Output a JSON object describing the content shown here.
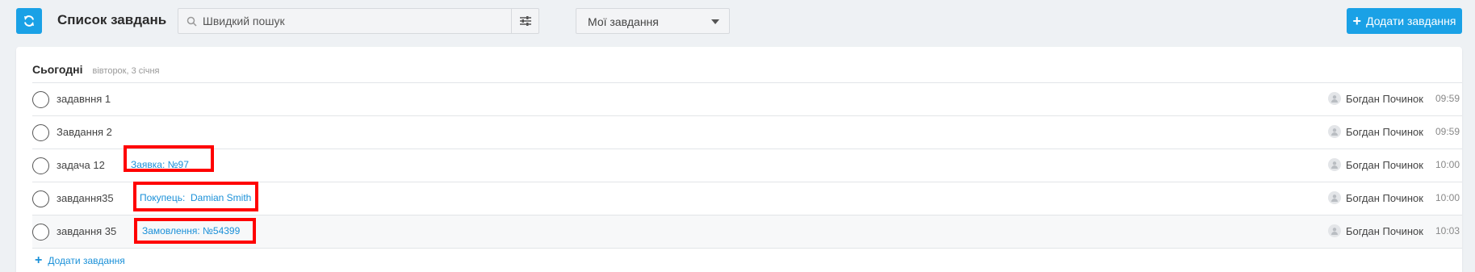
{
  "header": {
    "title": "Список завдань",
    "search_placeholder": "Швидкий пошук",
    "filter_selected": "Мої завдання",
    "add_button_label": "Додати завдання"
  },
  "section": {
    "title": "Сьогодні",
    "date": "вівторок, 3 січня"
  },
  "tasks": [
    {
      "title": "задавння 1",
      "link": "",
      "assignee": "Богдан Починок",
      "time": "09:59"
    },
    {
      "title": "Завдання 2",
      "link": "",
      "assignee": "Богдан Починок",
      "time": "09:59"
    },
    {
      "title": "задача 12",
      "link": "Заявка: №97",
      "assignee": "Богдан Починок",
      "time": "10:00"
    },
    {
      "title": "завдання35",
      "link": "Покупець:  Damian Smith",
      "assignee": "Богдан Починок",
      "time": "10:00"
    },
    {
      "title": "завдання 35",
      "link": "Замовлення: №54399",
      "assignee": "Богдан Починок",
      "time": "10:03"
    }
  ],
  "footer": {
    "add_task_label": "Додати завдання"
  },
  "colors": {
    "accent": "#1aa1e6",
    "link": "#1a90d8",
    "highlight": "#ff0000"
  }
}
